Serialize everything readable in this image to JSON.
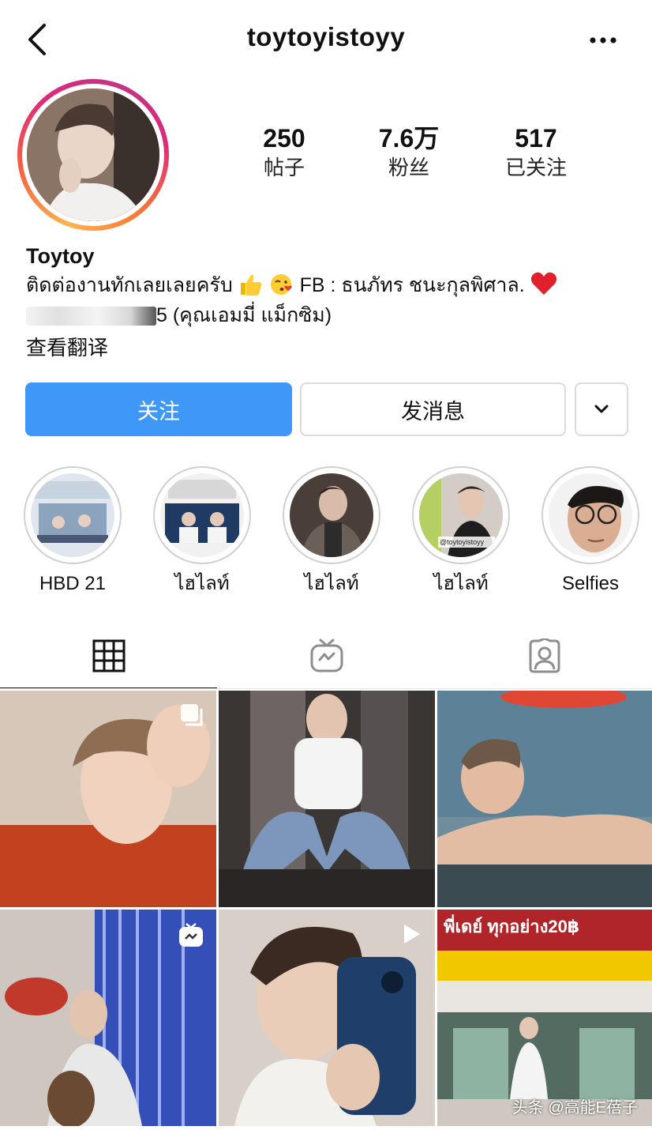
{
  "header": {
    "username": "toytoyistoyy",
    "back_icon": "chevron-left-icon",
    "more_icon": "more-horizontal-icon"
  },
  "stats": [
    {
      "value": "250",
      "label": "帖子"
    },
    {
      "value": "7.6万",
      "label": "粉丝"
    },
    {
      "value": "517",
      "label": "已关注"
    }
  ],
  "bio": {
    "name": "Toytoy",
    "line1_text": "ติดต่องานทักเลยเลยครับ",
    "line1_fb": "FB : ธนภัทร ชนะกุลพิศาล.",
    "line2_text": "5 (คุณเอมมี่ แม็กซิม)",
    "translate": "查看翻译"
  },
  "actions": {
    "follow": "关注",
    "message": "发消息",
    "dropdown_icon": "chevron-down-icon"
  },
  "highlights": [
    {
      "label": "HBD 21"
    },
    {
      "label": "ไฮไลท์"
    },
    {
      "label": "ไฮไลท์"
    },
    {
      "label": "ไฮไลท์"
    },
    {
      "label": "Selfies"
    }
  ],
  "highlight_overlay_text": "@toytoyistoyy",
  "tabs": [
    {
      "icon": "grid-icon",
      "active": true
    },
    {
      "icon": "igtv-icon",
      "active": false
    },
    {
      "icon": "tagged-icon",
      "active": false
    }
  ],
  "grid_overlay": {
    "billboard": "พี่เดย์ ทุกอย่าง20฿"
  },
  "watermark": "头条 @高能E蓓子",
  "colors": {
    "follow_button": "#3f98f7",
    "border": "#dbdbdb"
  }
}
